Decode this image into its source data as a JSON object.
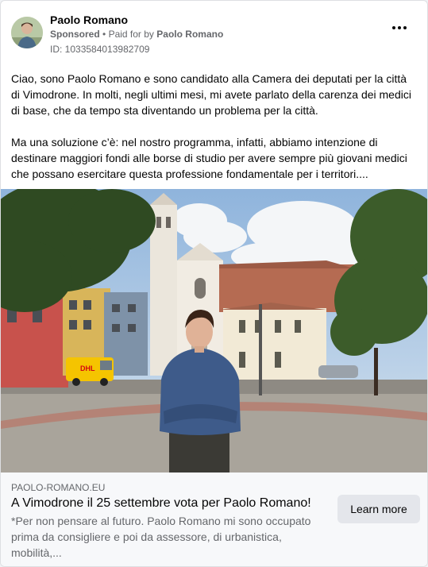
{
  "post": {
    "author": "Paolo Romano",
    "sponsored": "Sponsored",
    "paid_for_prefix": "Paid for by",
    "paid_for_name": "Paolo Romano",
    "id_line": "ID: 1033584013982709",
    "paragraph1": "Ciao, sono Paolo Romano e sono candidato alla Camera dei deputati per la città di Vimodrone. In molti, negli ultimi mesi, mi avete parlato della carenza dei medici di base, che da tempo sta diventando un problema per la città.",
    "paragraph2": "Ma una soluzione c’è: nel nostro programma, infatti, abbiamo intenzione di destinare maggiori fondi alle borse di studio per avere sempre più giovani medici che possano esercitare questa professione fondamentale per i territori...."
  },
  "photo": {
    "van_label": "DHL"
  },
  "link": {
    "domain": "PAOLO-ROMANO.EU",
    "headline": "A Vimodrone il 25 settembre vota per Paolo Romano!",
    "description": "*Per non pensare al futuro. Paolo Romano mi sono occupato prima da consigliere e poi da assessore, di urbanistica, mobilità,...",
    "cta": "Learn more"
  }
}
